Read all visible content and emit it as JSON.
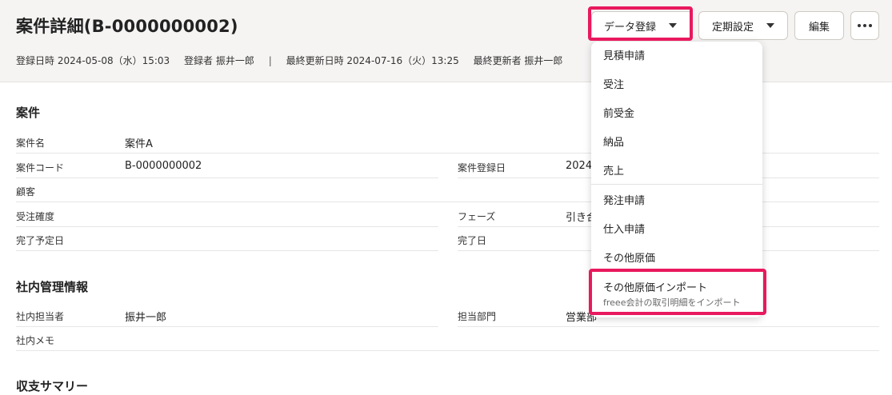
{
  "header": {
    "title": "案件詳細(B-0000000002)",
    "created_label": "登録日時",
    "created_value": "2024-05-08（水）15:03",
    "creator_label": "登録者",
    "creator_value": "振井一郎",
    "separator": "|",
    "updated_label": "最終更新日時",
    "updated_value": "2024-07-16（火）13:25",
    "updater_label": "最終更新者",
    "updater_value": "振井一郎"
  },
  "toolbar": {
    "data_register_label": "データ登録",
    "periodic_label": "定期設定",
    "edit_label": "編集"
  },
  "sections": {
    "case": {
      "title": "案件",
      "name_label": "案件名",
      "name_value": "案件A",
      "code_label": "案件コード",
      "code_value": "B-0000000002",
      "reg_date_label": "案件登録日",
      "reg_date_value": "2024",
      "customer_label": "顧客",
      "certainty_label": "受注確度",
      "phase_label": "フェーズ",
      "phase_value": "引き合",
      "due_label": "完了予定日",
      "done_label": "完了日"
    },
    "internal": {
      "title": "社内管理情報",
      "owner_label": "社内担当者",
      "owner_value": "振井一郎",
      "dept_label": "担当部門",
      "dept_value": "営業部",
      "memo_label": "社内メモ"
    },
    "summary": {
      "title": "収支サマリー"
    }
  },
  "dropdown": {
    "items": [
      {
        "label": "見積申請"
      },
      {
        "label": "受注"
      },
      {
        "label": "前受金"
      },
      {
        "label": "納品"
      },
      {
        "label": "売上"
      },
      {
        "label": "発注申請"
      },
      {
        "label": "仕入申請"
      },
      {
        "label": "その他原価"
      },
      {
        "label": "その他原価インポート",
        "sub": "freee会計の取引明細をインポート"
      }
    ]
  },
  "colors": {
    "highlight": "#e8195e",
    "header_bg": "#f5f4f3"
  },
  "icons": {
    "caret": "chevron-down-icon",
    "more": "more-horizontal-icon"
  }
}
